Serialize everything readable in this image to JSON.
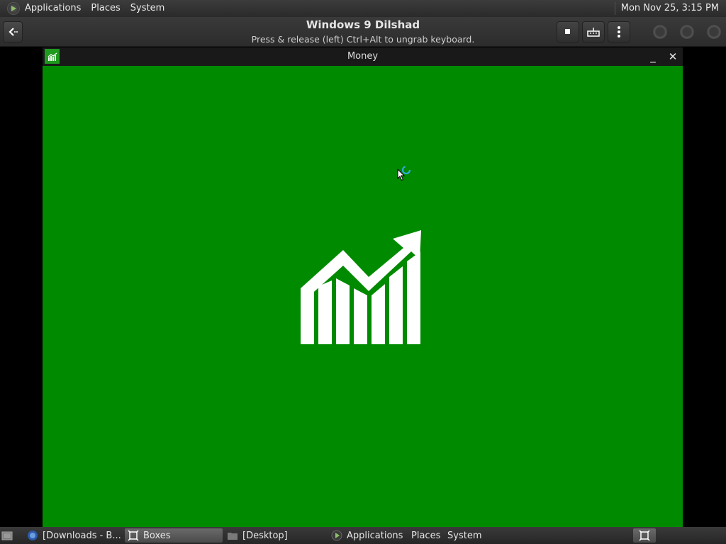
{
  "top_panel": {
    "menus": [
      "Applications",
      "Places",
      "System"
    ],
    "clock": "Mon Nov 25,  3:15 PM"
  },
  "boxes_header": {
    "title": "Windows 9  Dilshad",
    "subtitle": "Press & release (left) Ctrl+Alt to ungrab keyboard."
  },
  "money_window": {
    "title": "Money",
    "minimize_glyph": "_",
    "close_glyph": "✕",
    "background_color": "#008a00",
    "splash_icon": "chart-up-arrow-icon"
  },
  "taskbar": {
    "items": [
      {
        "label": "[Downloads - B...",
        "icon": "firefox-icon",
        "active": false
      },
      {
        "label": "Boxes",
        "icon": "boxes-icon",
        "active": true
      },
      {
        "label": "[Desktop]",
        "icon": "folder-icon",
        "active": false
      },
      {
        "label": "Applications",
        "icon": "app-menu-icon",
        "active": false
      },
      {
        "label": "Places",
        "active": false
      },
      {
        "label": "System",
        "active": false
      }
    ]
  }
}
